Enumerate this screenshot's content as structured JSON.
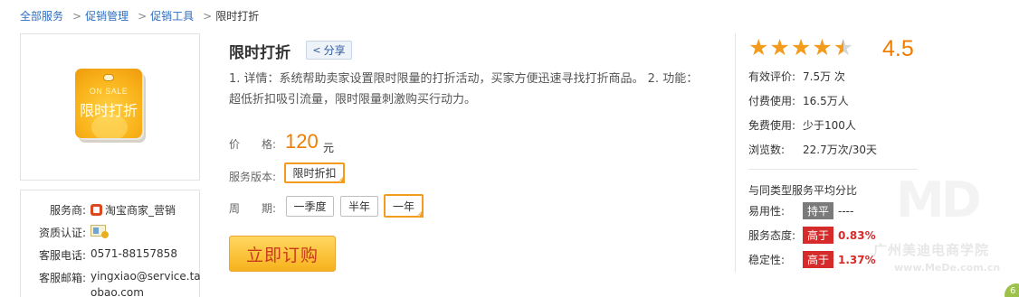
{
  "breadcrumb": {
    "items": [
      "全部服务",
      "促销管理",
      "促销工具"
    ],
    "current": "限时打折"
  },
  "product": {
    "image": {
      "onsale": "ON SALE",
      "title": "限时打折"
    },
    "title": "限时打折",
    "share_label": "分享",
    "description": "1. 详情：系统帮助卖家设置限时限量的打折活动，买家方便迅速寻找打折商品。 2. 功能：超低折扣吸引流量，限时限量刺激购买行动力。",
    "price_label": "价　　格:",
    "price": "120",
    "price_unit": "元",
    "version_label": "服务版本:",
    "versions": [
      {
        "label": "限时折扣",
        "selected": true
      }
    ],
    "period_label": "周　　期:",
    "periods": [
      {
        "label": "一季度",
        "selected": false
      },
      {
        "label": "半年",
        "selected": false
      },
      {
        "label": "一年",
        "selected": true
      }
    ],
    "buy_label": "立即订购"
  },
  "seller": {
    "provider_label": "服务商:",
    "provider": "淘宝商家_营销",
    "cert_label": "资质认证:",
    "phone_label": "客服电话:",
    "phone": "0571-88157858",
    "email_label": "客服邮箱:",
    "email_line1": "yingxiao@service.ta",
    "email_line2": "obao.com"
  },
  "rating": {
    "score": "4.5",
    "stars_value": 4.5,
    "stats": [
      {
        "label": "有效评价:",
        "value": "7.5万 次"
      },
      {
        "label": "付费使用:",
        "value": "16.5万人"
      },
      {
        "label": "免费使用:",
        "value": "少于100人"
      },
      {
        "label": "浏览数:",
        "value": "22.7万次/30天"
      }
    ],
    "compare_title": "与同类型服务平均分比",
    "compare": [
      {
        "label": "易用性:",
        "badge": "持平",
        "badge_color": "#7a7a7a",
        "value": "----"
      },
      {
        "label": "服务态度:",
        "badge": "高于",
        "badge_color": "#d52b2b",
        "value": "0.83%"
      },
      {
        "label": "稳定性:",
        "badge": "高于",
        "badge_color": "#d52b2b",
        "value": "1.37%"
      }
    ]
  },
  "watermark": {
    "name": "广州美迪电商学院",
    "url": "www.MeDe.com.cn",
    "corner": "6"
  },
  "colors": {
    "accent": "#f07c00",
    "link": "#2e6ec0",
    "selected_border": "#f29b1d",
    "danger": "#d52b2b"
  }
}
